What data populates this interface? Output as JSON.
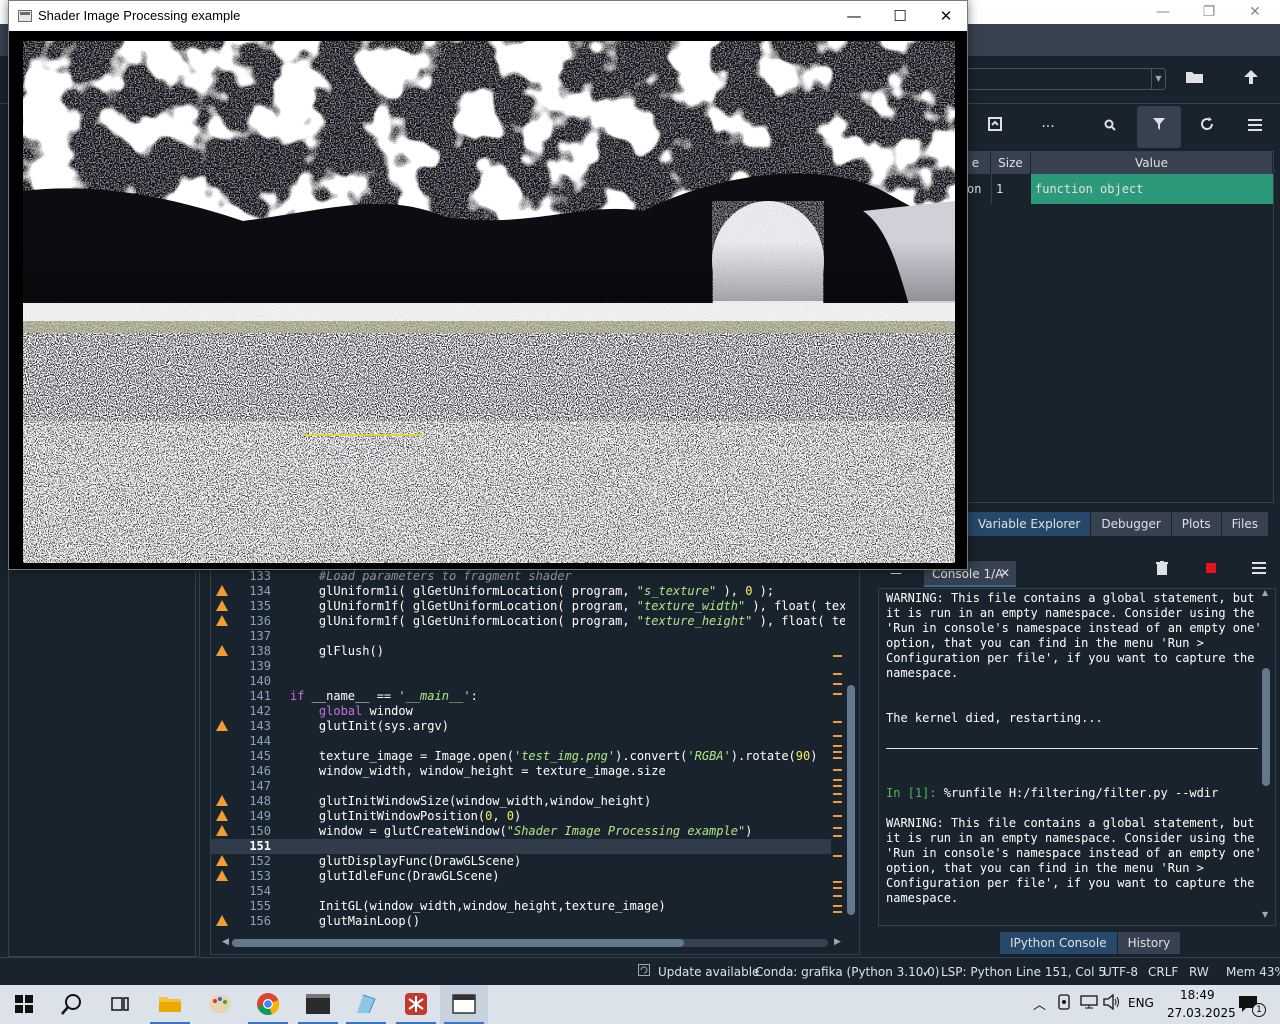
{
  "gl_window": {
    "title": "Shader Image Processing example",
    "controls": {
      "minimize": "—",
      "maximize": "☐",
      "close": "✕"
    }
  },
  "spyder": {
    "titlebar_controls": {
      "minimize": "—",
      "restore": "❐",
      "close": "✕"
    },
    "variable_explorer": {
      "columns": [
        "e",
        "Size",
        "Value"
      ],
      "row": {
        "type": "on",
        "size": "1",
        "value": "function object"
      },
      "pane_tabs": [
        "Variable Explorer",
        "Debugger",
        "Plots",
        "Files"
      ]
    },
    "editor": {
      "lines": [
        {
          "n": "133",
          "warn": false,
          "code": [
            [
              "cmt",
              "#Load parameters to fragment shader"
            ]
          ]
        },
        {
          "n": "134",
          "warn": true,
          "code": [
            [
              "p",
              "glUniform1i( glGetUniformLocation( program, "
            ],
            [
              "str",
              "\"s_texture\""
            ],
            [
              "p",
              " ), "
            ],
            [
              "numlit",
              "0"
            ],
            [
              "p",
              " );"
            ]
          ]
        },
        {
          "n": "135",
          "warn": true,
          "code": [
            [
              "p",
              "glUniform1f( glGetUniformLocation( program, "
            ],
            [
              "str",
              "\"texture_width\""
            ],
            [
              "p",
              " ), float( text"
            ]
          ]
        },
        {
          "n": "136",
          "warn": true,
          "code": [
            [
              "p",
              "glUniform1f( glGetUniformLocation( program, "
            ],
            [
              "str",
              "\"texture_height\""
            ],
            [
              "p",
              " ), float( tex"
            ]
          ]
        },
        {
          "n": "137",
          "warn": false,
          "code": []
        },
        {
          "n": "138",
          "warn": true,
          "code": [
            [
              "p",
              "glFlush()"
            ]
          ]
        },
        {
          "n": "139",
          "warn": false,
          "code": []
        },
        {
          "n": "140",
          "warn": false,
          "code": []
        },
        {
          "n": "141",
          "warn": false,
          "indent": 0,
          "code": [
            [
              "kw",
              "if"
            ],
            [
              "p",
              " __name__ == "
            ],
            [
              "str",
              "'__main__'"
            ],
            [
              "p",
              ":"
            ]
          ]
        },
        {
          "n": "142",
          "warn": false,
          "code": [
            [
              "kw",
              "global"
            ],
            [
              "p",
              " window"
            ]
          ]
        },
        {
          "n": "143",
          "warn": true,
          "code": [
            [
              "p",
              "glutInit(sys.argv)"
            ]
          ]
        },
        {
          "n": "144",
          "warn": false,
          "code": []
        },
        {
          "n": "145",
          "warn": false,
          "code": [
            [
              "p",
              "texture_image = Image.open("
            ],
            [
              "str",
              "'test_img.png'"
            ],
            [
              "p",
              ").convert("
            ],
            [
              "str",
              "'RGBA'"
            ],
            [
              "p",
              ").rotate("
            ],
            [
              "numlit",
              "90"
            ],
            [
              "p",
              ")"
            ]
          ]
        },
        {
          "n": "146",
          "warn": false,
          "code": [
            [
              "p",
              "window_width, window_height = texture_image.size"
            ]
          ]
        },
        {
          "n": "147",
          "warn": false,
          "code": []
        },
        {
          "n": "148",
          "warn": true,
          "code": [
            [
              "p",
              "glutInitWindowSize(window_width,window_height)"
            ]
          ]
        },
        {
          "n": "149",
          "warn": true,
          "code": [
            [
              "p",
              "glutInitWindowPosition("
            ],
            [
              "numlit",
              "0"
            ],
            [
              "p",
              ", "
            ],
            [
              "numlit",
              "0"
            ],
            [
              "p",
              ")"
            ]
          ]
        },
        {
          "n": "150",
          "warn": true,
          "code": [
            [
              "p",
              "window = glutCreateWindow("
            ],
            [
              "str",
              "\"Shader Image Processing example\""
            ],
            [
              "p",
              ")"
            ]
          ]
        },
        {
          "n": "151",
          "warn": false,
          "current": true,
          "code": []
        },
        {
          "n": "152",
          "warn": true,
          "code": [
            [
              "p",
              "glutDisplayFunc(DrawGLScene)"
            ]
          ]
        },
        {
          "n": "153",
          "warn": true,
          "code": [
            [
              "p",
              "glutIdleFunc(DrawGLScene)"
            ]
          ]
        },
        {
          "n": "154",
          "warn": false,
          "code": []
        },
        {
          "n": "155",
          "warn": false,
          "code": [
            [
              "p",
              "InitGL(window_width,window_height,texture_image)"
            ]
          ]
        },
        {
          "n": "156",
          "warn": true,
          "code": [
            [
              "p",
              "glutMainLoop()"
            ]
          ]
        }
      ]
    },
    "console": {
      "tab_label": "Console 1/A",
      "tab_close": "✕",
      "lines": [
        {
          "t": "WARNING: This file contains a global statement, but"
        },
        {
          "t": "it is run in an empty namespace. Consider using the"
        },
        {
          "t": "'Run in console's namespace instead of an empty one'"
        },
        {
          "t": "option, that you can find in the menu 'Run >"
        },
        {
          "t": "Configuration per file', if you want to capture the"
        },
        {
          "t": "namespace."
        },
        {
          "t": ""
        },
        {
          "t": ""
        },
        {
          "t": "The kernel died, restarting..."
        },
        {
          "t": ""
        },
        {
          "t": "",
          "rule": true
        },
        {
          "t": ""
        },
        {
          "t": ""
        },
        {
          "prompt": "In [1]: ",
          "t": "%runfile H:/filtering/filter.py --wdir"
        },
        {
          "t": ""
        },
        {
          "t": "WARNING: This file contains a global statement, but"
        },
        {
          "t": "it is run in an empty namespace. Consider using the"
        },
        {
          "t": "'Run in console's namespace instead of an empty one'"
        },
        {
          "t": "option, that you can find in the menu 'Run >"
        },
        {
          "t": "Configuration per file', if you want to capture the"
        },
        {
          "t": "namespace."
        }
      ],
      "pane_tabs": [
        "IPython Console",
        "History"
      ]
    },
    "statusbar": {
      "update": "Update available",
      "conda": "Conda: grafika (Python 3.10.0)",
      "lsp": "LSP: Python",
      "position": "Line 151, Col 5",
      "encoding": "UTF-8",
      "eol": "CRLF",
      "rw": "RW",
      "mem": "Mem 43%"
    }
  },
  "taskbar": {
    "language": "ENG",
    "time": "18:49",
    "date": "27.03.2025",
    "notification_count": "1"
  },
  "colors": {
    "spyder_bg": "#19232d",
    "accent": "#26486b",
    "warning": "#f39c36",
    "selected_row": "#2c9a7a"
  }
}
